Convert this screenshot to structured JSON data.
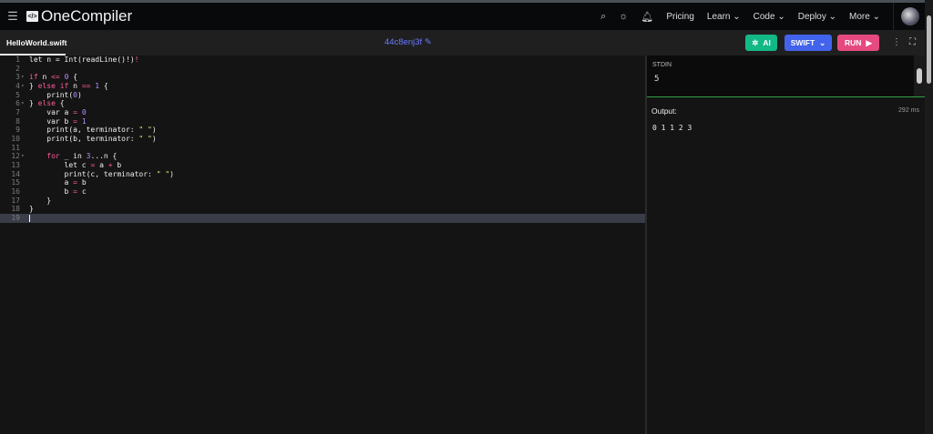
{
  "nav": {
    "brand": "OneCompiler",
    "brand_icon": "</>",
    "links": [
      "Pricing",
      "Learn",
      "Code",
      "Deploy",
      "More"
    ]
  },
  "toolbar": {
    "filename": "HelloWorld.swift",
    "hash": "44c8enj3f",
    "ai_label": "AI",
    "language": "SWIFT",
    "run_label": "RUN"
  },
  "editor": {
    "lines": [
      [
        [
          "let n ",
          ""
        ],
        [
          "=",
          ""
        ],
        [
          " Int(readLine()",
          ""
        ],
        [
          "!",
          ""
        ],
        [
          ")",
          ""
        ],
        [
          "!",
          "op"
        ]
      ],
      [],
      [
        [
          "if",
          "kw"
        ],
        [
          " n ",
          ""
        ],
        [
          "<=",
          "op"
        ],
        [
          " ",
          ""
        ],
        [
          "0",
          "nm"
        ],
        [
          " {",
          ""
        ]
      ],
      [
        [
          "} ",
          ""
        ],
        [
          "else if",
          "kw"
        ],
        [
          " n ",
          ""
        ],
        [
          "==",
          "op"
        ],
        [
          " ",
          ""
        ],
        [
          "1",
          "nm"
        ],
        [
          " {",
          ""
        ]
      ],
      [
        [
          "    print(",
          ""
        ],
        [
          "0",
          "nm"
        ],
        [
          ")",
          ""
        ]
      ],
      [
        [
          "} ",
          ""
        ],
        [
          "else",
          "kw"
        ],
        [
          " {",
          ""
        ]
      ],
      [
        [
          "    var a ",
          ""
        ],
        [
          "=",
          "op"
        ],
        [
          " ",
          ""
        ],
        [
          "0",
          "nm"
        ]
      ],
      [
        [
          "    var b ",
          ""
        ],
        [
          "=",
          "op"
        ],
        [
          " ",
          ""
        ],
        [
          "1",
          "nm"
        ]
      ],
      [
        [
          "    print(a, terminator: ",
          ""
        ],
        [
          "\" \"",
          "st"
        ],
        [
          ")",
          ""
        ]
      ],
      [
        [
          "    print(b, terminator: ",
          ""
        ],
        [
          "\" \"",
          "st"
        ],
        [
          ")",
          ""
        ]
      ],
      [],
      [
        [
          "    ",
          ""
        ],
        [
          "for",
          "kw"
        ],
        [
          " _ in ",
          ""
        ],
        [
          "3",
          "nm"
        ],
        [
          "...n {",
          ""
        ]
      ],
      [
        [
          "        let c ",
          ""
        ],
        [
          "=",
          "op"
        ],
        [
          " a ",
          ""
        ],
        [
          "+",
          "op"
        ],
        [
          " b",
          ""
        ]
      ],
      [
        [
          "        print(c, terminator: ",
          ""
        ],
        [
          "\" \"",
          "st"
        ],
        [
          ")",
          ""
        ]
      ],
      [
        [
          "        a ",
          ""
        ],
        [
          "=",
          "op"
        ],
        [
          " b",
          ""
        ]
      ],
      [
        [
          "        b ",
          ""
        ],
        [
          "=",
          "op"
        ],
        [
          " c",
          ""
        ]
      ],
      [
        [
          "    }",
          ""
        ]
      ],
      [
        [
          "}",
          ""
        ]
      ],
      []
    ],
    "folds": [
      3,
      4,
      6,
      12
    ]
  },
  "stdin": {
    "label": "STDIN",
    "value": "5"
  },
  "output": {
    "label": "Output:",
    "time": "292 ms",
    "value": "0 1 1 2 3"
  }
}
